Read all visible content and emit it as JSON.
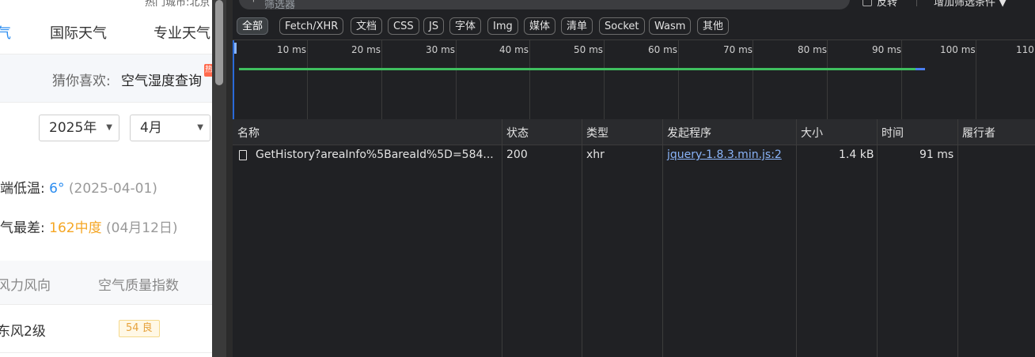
{
  "weather": {
    "hot_city": "热门城市:北京",
    "nav": [
      "气",
      "国际天气",
      "专业天气"
    ],
    "guess_label": "猜你喜欢:",
    "guess_link": "空气湿度查询",
    "guess_badge": "热",
    "year_select": "2025年",
    "month_select": "4月",
    "min_temp_label": "端低温:",
    "min_temp_value": "6°",
    "min_temp_date": "(2025-04-01)",
    "worst_air_label": "气最差:",
    "worst_air_value": "162中度",
    "worst_air_date": "(04月12日)",
    "table_headers": [
      "风力风向",
      "空气质量指数"
    ],
    "row": {
      "wind": "东风2级",
      "aqi": "54 良"
    }
  },
  "devtools": {
    "filter_placeholder": "筛选器",
    "invert_label": "反转",
    "more_filters": "增加筛选条件",
    "chips": [
      "全部",
      "Fetch/XHR",
      "文档",
      "CSS",
      "JS",
      "字体",
      "Img",
      "媒体",
      "清单",
      "Socket",
      "Wasm",
      "其他"
    ],
    "timeline_labels": [
      "10 ms",
      "20 ms",
      "30 ms",
      "40 ms",
      "50 ms",
      "60 ms",
      "70 ms",
      "80 ms",
      "90 ms",
      "100 ms",
      "110"
    ],
    "columns": [
      "名称",
      "状态",
      "类型",
      "发起程序",
      "大小",
      "时间",
      "履行者"
    ],
    "request": {
      "name": "GetHistory?areaInfo%5BareaId%5D=584...",
      "status": "200",
      "type": "xhr",
      "initiator": "jquery-1.8.3.min.js:2",
      "size": "1.4 kB",
      "time": "91 ms"
    }
  }
}
